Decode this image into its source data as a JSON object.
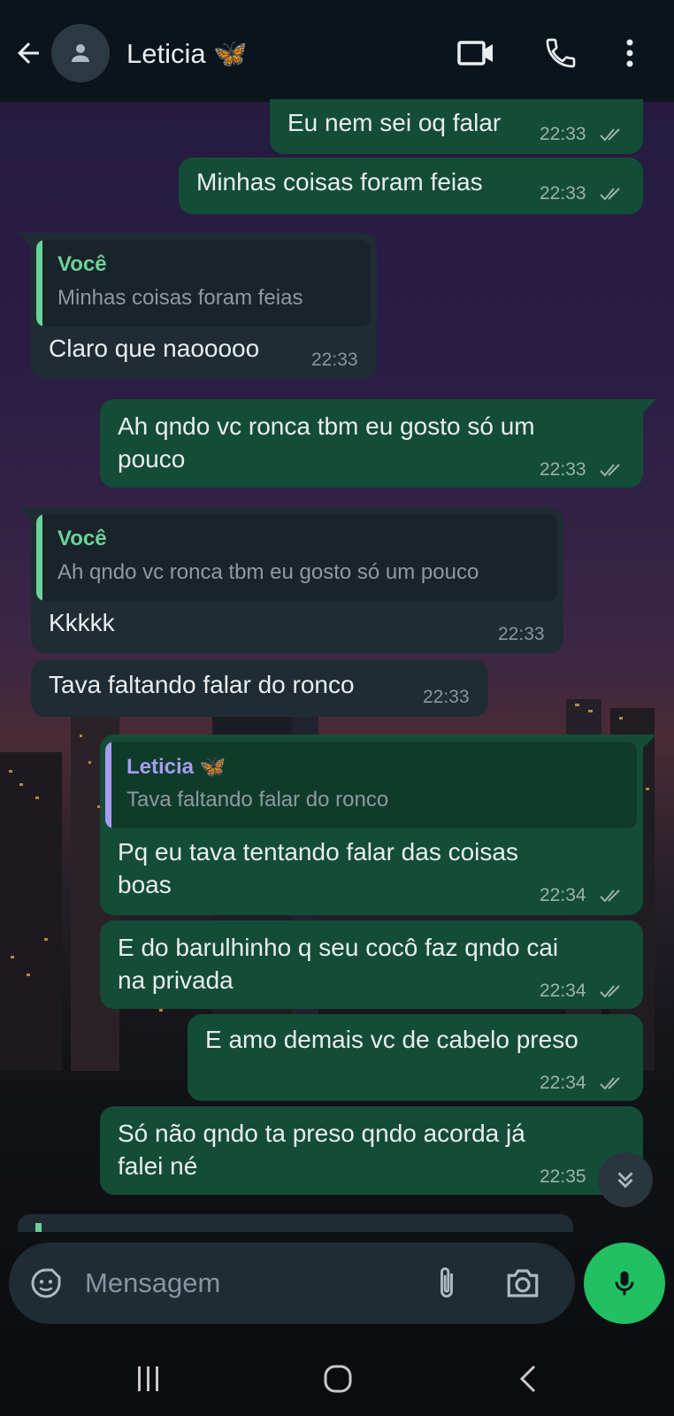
{
  "header": {
    "contact_name": "Leticia",
    "contact_emoji": "🦋"
  },
  "messages": [
    {
      "dir": "out",
      "text": "Eu nem sei oq falar",
      "time": "22:33",
      "ticks": "read"
    },
    {
      "dir": "out",
      "text": "Minhas coisas foram feias",
      "time": "22:33",
      "ticks": "read"
    },
    {
      "dir": "in",
      "quote_name": "Você",
      "quote_text": "Minhas coisas foram feias",
      "text": "Claro que naooooo",
      "time": "22:33"
    },
    {
      "dir": "out",
      "text_line1": "Ah qndo vc ronca tbm eu gosto só um",
      "text_line2": "pouco",
      "time": "22:33",
      "ticks": "read"
    },
    {
      "dir": "in",
      "quote_name": "Você",
      "quote_text": "Ah qndo vc ronca tbm eu gosto só um pouco",
      "text": "Kkkkk",
      "time": "22:33"
    },
    {
      "dir": "in",
      "text": "Tava faltando falar do ronco",
      "time": "22:33"
    },
    {
      "dir": "out",
      "quote_name": "Leticia 🦋",
      "quote_text": "Tava faltando falar do ronco",
      "text_line1": "Pq eu tava tentando falar das coisas",
      "text_line2": "boas",
      "time": "22:34",
      "ticks": "read"
    },
    {
      "dir": "out",
      "text_line1": "E do barulhinho q seu cocô faz qndo cai",
      "text_line2": "na privada",
      "time": "22:34",
      "ticks": "read"
    },
    {
      "dir": "out",
      "text": "E amo demais vc de cabelo preso",
      "time": "22:34",
      "ticks": "read"
    },
    {
      "dir": "out",
      "text_line1": "Só não qndo ta preso qndo acorda já",
      "text_line2": "falei né",
      "time": "22:35",
      "ticks": "read"
    }
  ],
  "input": {
    "placeholder": "Mensagem"
  },
  "colors": {
    "outgoing": "#144d37",
    "incoming": "#202c33",
    "accent": "#21c063",
    "quote_self": "#6bd29b",
    "quote_contact": "#a79cf0"
  },
  "icons": [
    "back-arrow-icon",
    "avatar-icon",
    "video-call-icon",
    "phone-icon",
    "more-vert-icon",
    "sticker-icon",
    "attach-icon",
    "camera-icon",
    "mic-icon",
    "scroll-down-icon"
  ]
}
